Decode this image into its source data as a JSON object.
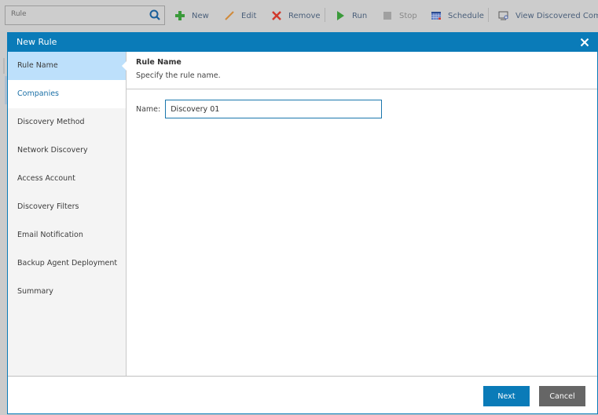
{
  "toolbar": {
    "search": {
      "value": "Rule",
      "icon": "search-icon"
    },
    "buttons": [
      {
        "label": "New",
        "icon": "plus-icon",
        "color": "#3a9a3a"
      },
      {
        "label": "Edit",
        "icon": "pencil-icon",
        "color": "#d08a3a"
      },
      {
        "label": "Remove",
        "icon": "x-icon",
        "color": "#d0392b"
      },
      {
        "label": "Run",
        "icon": "play-icon",
        "color": "#3a9a3a"
      },
      {
        "label": "Stop",
        "icon": "stop-icon",
        "color": "#9a9a9a"
      },
      {
        "label": "Schedule",
        "icon": "calendar-icon",
        "color": "#4a66b0"
      },
      {
        "label": "View Discovered Compu",
        "icon": "monitor-search-icon",
        "color": "#5a5a5a"
      }
    ]
  },
  "modal": {
    "title": "New Rule",
    "close_icon": "close-icon",
    "steps": [
      {
        "label": "Rule Name",
        "state": "active"
      },
      {
        "label": "Companies",
        "state": "next"
      },
      {
        "label": "Discovery Method",
        "state": "pending"
      },
      {
        "label": "Network Discovery",
        "state": "pending"
      },
      {
        "label": "Access Account",
        "state": "pending"
      },
      {
        "label": "Discovery Filters",
        "state": "pending"
      },
      {
        "label": "Email Notification",
        "state": "pending"
      },
      {
        "label": "Backup Agent Deployment",
        "state": "pending"
      },
      {
        "label": "Summary",
        "state": "pending"
      }
    ],
    "content": {
      "title": "Rule Name",
      "description": "Specify the rule name.",
      "name_label": "Name:",
      "name_value": "Discovery 01"
    },
    "footer": {
      "next_label": "Next",
      "cancel_label": "Cancel"
    },
    "colors": {
      "accent": "#0a7bb8",
      "active_step": "#bde0fb",
      "cancel": "#666666"
    }
  }
}
